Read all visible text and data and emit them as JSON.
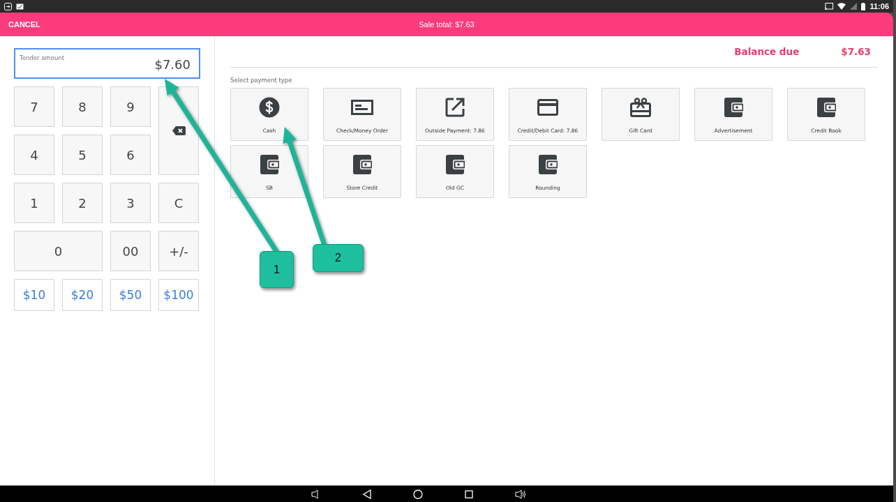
{
  "status_bar": {
    "time": "11:06"
  },
  "header": {
    "cancel": "CANCEL",
    "title": "Sale total: $7.63"
  },
  "tender": {
    "label": "Tender amount",
    "value": "$7.60",
    "focused": true
  },
  "keypad": [
    {
      "label": "7",
      "kind": "digit"
    },
    {
      "label": "8",
      "kind": "digit"
    },
    {
      "label": "9",
      "kind": "digit"
    },
    {
      "kind": "backspace"
    },
    {
      "label": "4",
      "kind": "digit"
    },
    {
      "label": "5",
      "kind": "digit"
    },
    {
      "label": "6",
      "kind": "digit"
    },
    {
      "label": "1",
      "kind": "digit"
    },
    {
      "label": "2",
      "kind": "digit"
    },
    {
      "label": "3",
      "kind": "digit"
    },
    {
      "label": "C",
      "kind": "digit"
    },
    {
      "label": "0",
      "kind": "wide"
    },
    {
      "label": "00",
      "kind": "digit"
    },
    {
      "label": "+/-",
      "kind": "digit"
    },
    {
      "label": "$10",
      "kind": "quick"
    },
    {
      "label": "$20",
      "kind": "quick"
    },
    {
      "label": "$50",
      "kind": "quick"
    },
    {
      "label": "$100",
      "kind": "quick"
    }
  ],
  "balance": {
    "label": "Balance due",
    "value": "$7.63"
  },
  "payment": {
    "label": "Select payment type",
    "types": [
      {
        "name": "Cash",
        "kind": "dollar"
      },
      {
        "name": "Check/Money Order",
        "kind": "check"
      },
      {
        "name": "Outside Payment: 7.86",
        "kind": "external"
      },
      {
        "name": "Credit/Debit Card: 7.86",
        "kind": "card"
      },
      {
        "name": "Gift Card",
        "kind": "gift"
      },
      {
        "name": "Advertisement",
        "kind": "wallet"
      },
      {
        "name": "Credit Book",
        "kind": "wallet"
      },
      {
        "name": "SB",
        "kind": "wallet"
      },
      {
        "name": "Store Credit",
        "kind": "wallet"
      },
      {
        "name": "Old GC",
        "kind": "wallet"
      },
      {
        "name": "Rounding",
        "kind": "wallet"
      }
    ]
  },
  "callouts": [
    {
      "label": "1"
    },
    {
      "label": "2"
    }
  ]
}
